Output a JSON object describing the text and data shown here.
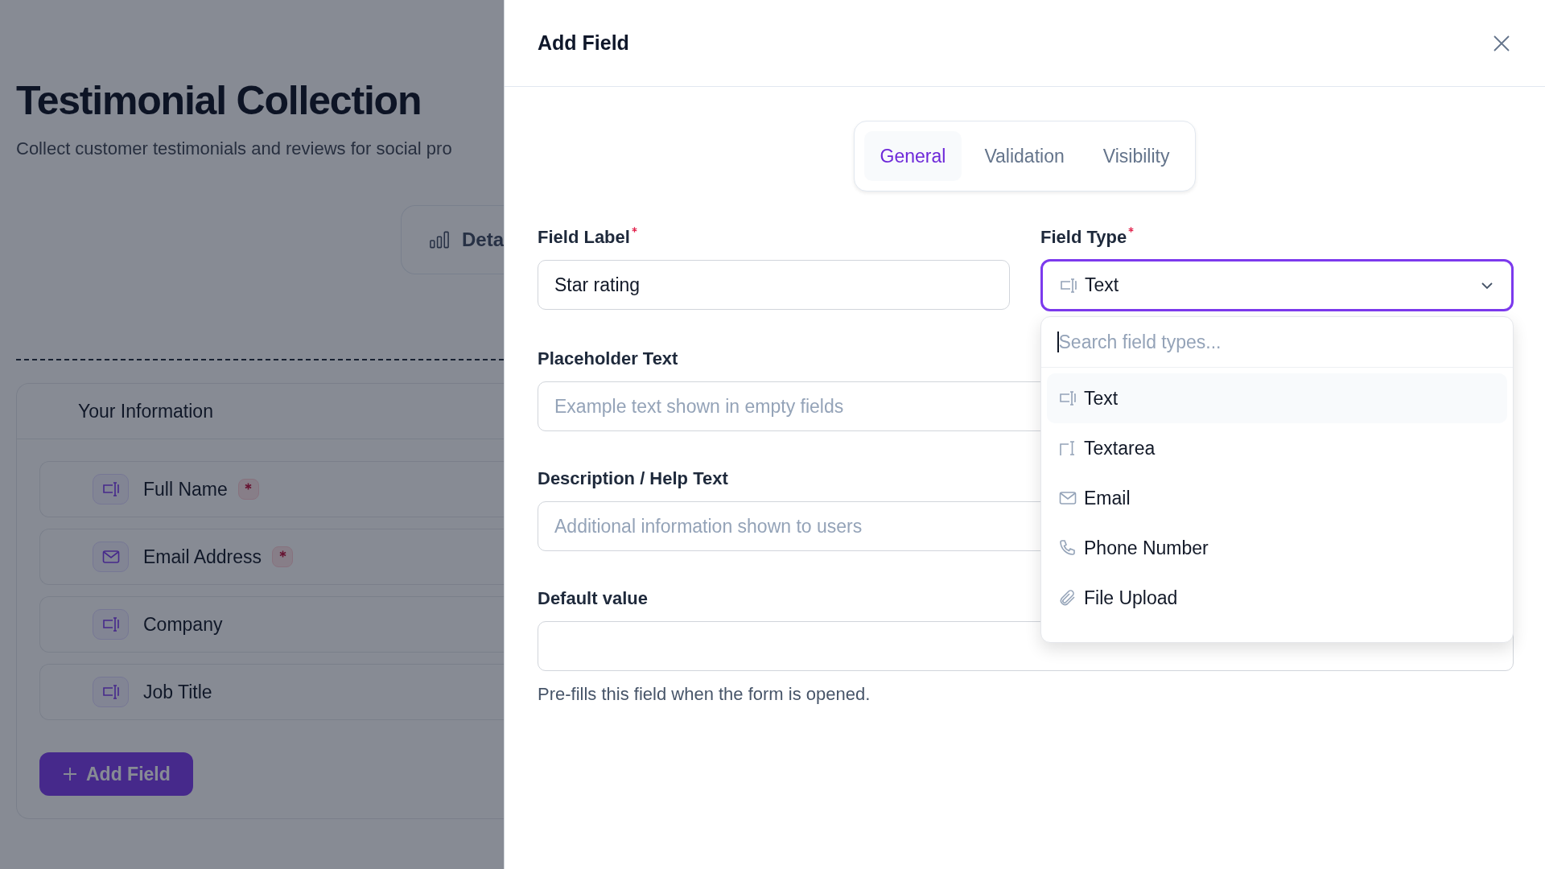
{
  "page": {
    "title": "Testimonial Collection",
    "subtitle": "Collect customer testimonials and reviews for social pro",
    "details_button": "Deta",
    "section": {
      "title": "Your Information",
      "fields": [
        {
          "label": "Full Name",
          "kind": "text",
          "required": true
        },
        {
          "label": "Email Address",
          "kind": "email",
          "required": true
        },
        {
          "label": "Company",
          "kind": "text",
          "required": false
        },
        {
          "label": "Job Title",
          "kind": "text",
          "required": false
        }
      ],
      "add_button": "Add Field"
    }
  },
  "dialog": {
    "title": "Add Field",
    "tabs": [
      {
        "label": "General",
        "selected": true
      },
      {
        "label": "Validation",
        "selected": false
      },
      {
        "label": "Visibility",
        "selected": false
      }
    ],
    "field_label": {
      "label": "Field Label",
      "required": true,
      "value": "Star rating"
    },
    "field_type": {
      "label": "Field Type",
      "required": true,
      "value": "Text",
      "kind": "text",
      "open": true
    },
    "placeholder_text": {
      "label": "Placeholder Text",
      "placeholder": "Example text shown in empty fields"
    },
    "description": {
      "label": "Description / Help Text",
      "placeholder": "Additional information shown to users"
    },
    "default_value": {
      "label": "Default value",
      "help": "Pre-fills this field when the form is opened."
    },
    "dropdown": {
      "search_placeholder": "Search field types...",
      "options": [
        {
          "label": "Text",
          "kind": "text",
          "selected": true
        },
        {
          "label": "Textarea",
          "kind": "textarea",
          "selected": false
        },
        {
          "label": "Email",
          "kind": "email",
          "selected": false
        },
        {
          "label": "Phone Number",
          "kind": "phone",
          "selected": false
        },
        {
          "label": "File Upload",
          "kind": "file",
          "selected": false
        }
      ]
    }
  }
}
